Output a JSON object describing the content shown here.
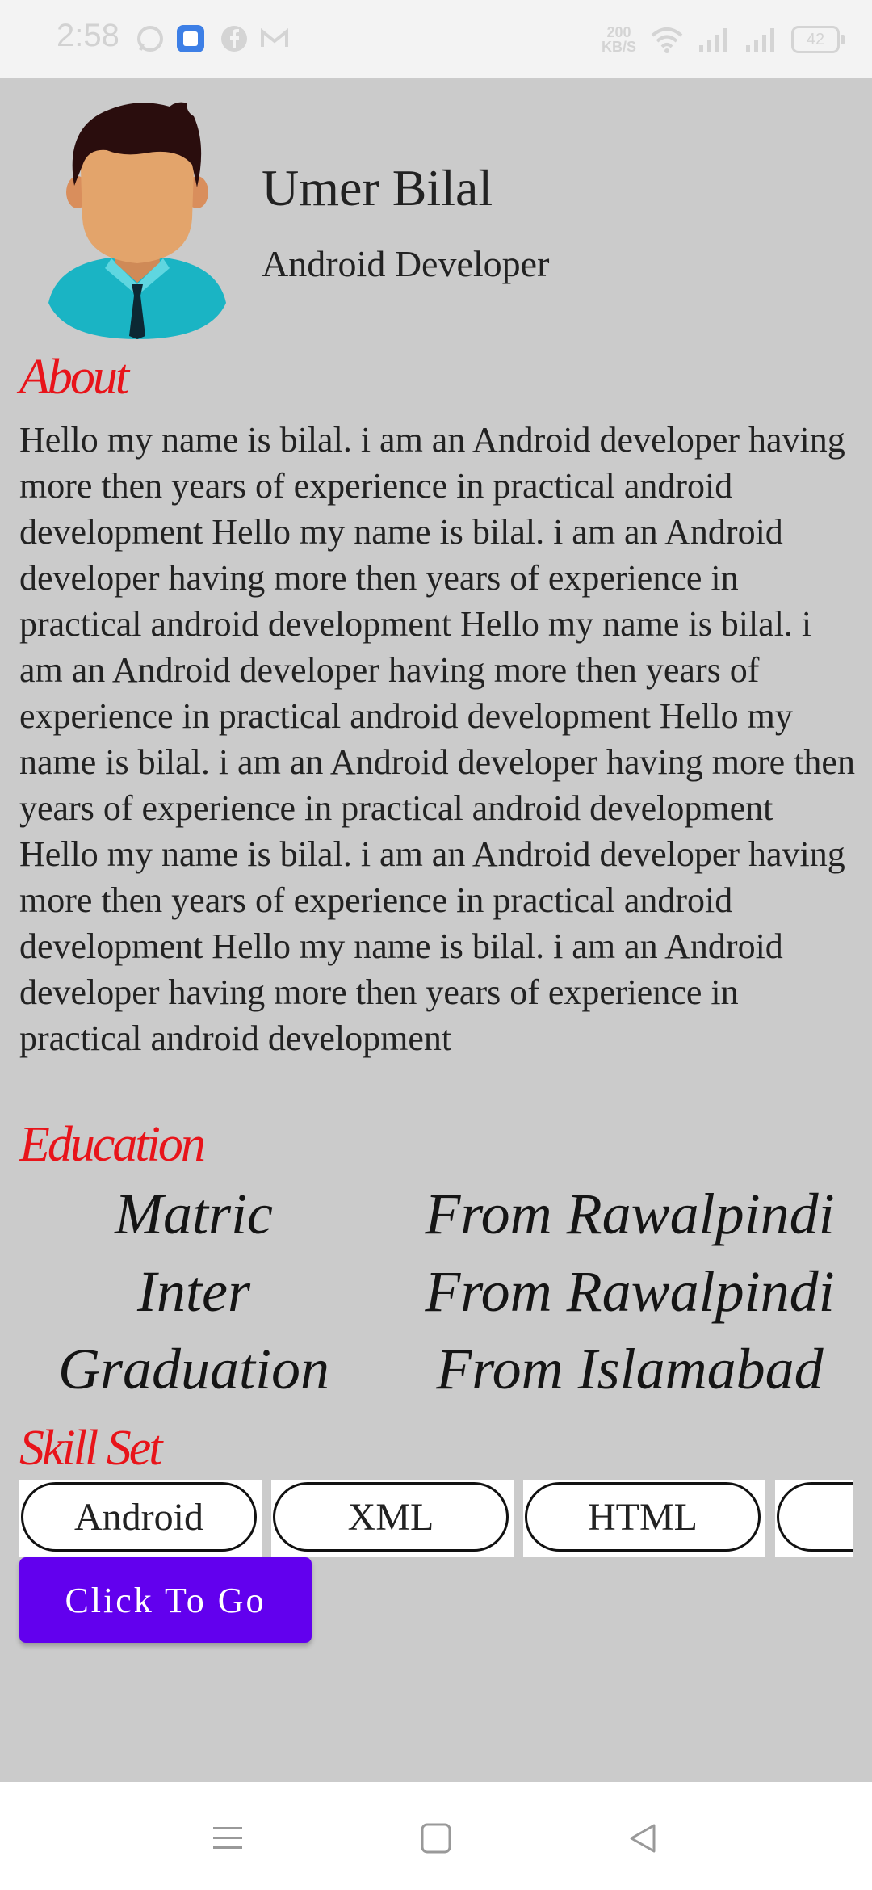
{
  "status_bar": {
    "time": "2:58",
    "net_speed_value": "200",
    "net_speed_unit": "KB/S",
    "battery": "42",
    "icons": [
      "whatsapp-icon",
      "app-icon",
      "facebook-icon",
      "gmail-icon",
      "wifi-icon",
      "signal-icon",
      "signal-icon",
      "battery-icon"
    ]
  },
  "profile": {
    "name": "Umer Bilal",
    "role": "Android Developer"
  },
  "about": {
    "title": "About",
    "text": "Hello my name is bilal. i am an Android developer  having more then years of experience in practical android development Hello my name is bilal. i am an Android developer  having more then years of experience in practical android development Hello my name is bilal. i am an Android developer  having more then years of experience in practical android development Hello my name is bilal. i am an Android developer  having more then years of experience in practical android development Hello my name is bilal. i am an Android developer  having more then years of experience in practical android development Hello my name is bilal. i am an Android developer  having more then years of experience in practical android development"
  },
  "education": {
    "title": "Education",
    "rows": [
      {
        "level": "Matric",
        "place": "From Rawalpindi"
      },
      {
        "level": "Inter",
        "place": "From Rawalpindi"
      },
      {
        "level": "Graduation",
        "place": "From Islamabad"
      }
    ]
  },
  "skills": {
    "title": "Skill Set",
    "items": [
      "Android",
      "XML",
      "HTML",
      ""
    ]
  },
  "actions": {
    "go_label": "Click To Go"
  },
  "colors": {
    "accent": "#6200ee",
    "section_title": "#e8141a",
    "background": "#cbcbcb"
  }
}
